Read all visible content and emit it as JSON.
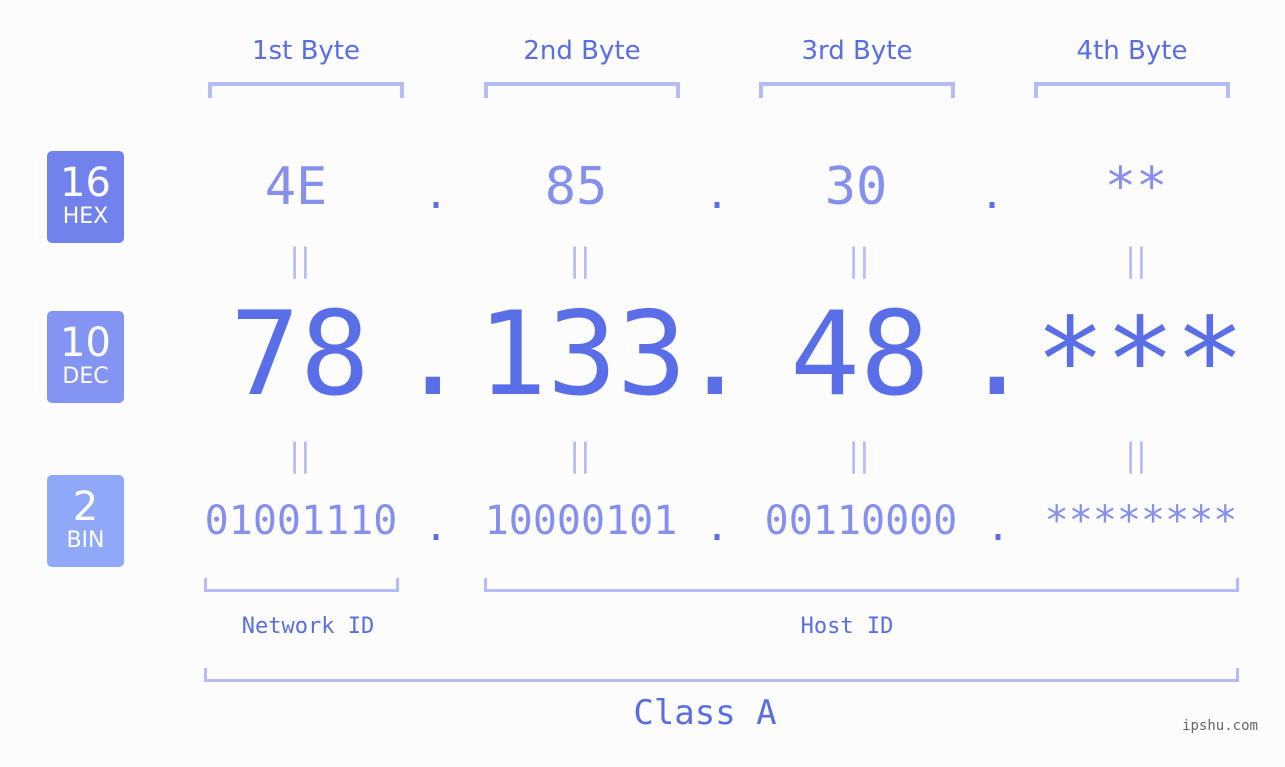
{
  "badges": [
    {
      "number": "16",
      "label": "HEX",
      "color": "#7282ec"
    },
    {
      "number": "10",
      "label": "DEC",
      "color": "#8494f2"
    },
    {
      "number": "2",
      "label": "BIN",
      "color": "#8fa8f8"
    }
  ],
  "byte_headers": [
    "1st Byte",
    "2nd Byte",
    "3rd Byte",
    "4th Byte"
  ],
  "hex": [
    "4E",
    "85",
    "30",
    "**"
  ],
  "dec": [
    "78",
    "133",
    "48",
    "***"
  ],
  "bin": [
    "01001110",
    "10000101",
    "00110000",
    "********"
  ],
  "separator": ".",
  "equals": "=",
  "network_id_label": "Network ID",
  "host_id_label": "Host ID",
  "class_label": "Class A",
  "watermark": "ipshu.com",
  "colors": {
    "accent": "#5a6ee8",
    "bracket": "#b3bcf5",
    "light_value": "#8590ec",
    "background": "#fbfcfb"
  }
}
